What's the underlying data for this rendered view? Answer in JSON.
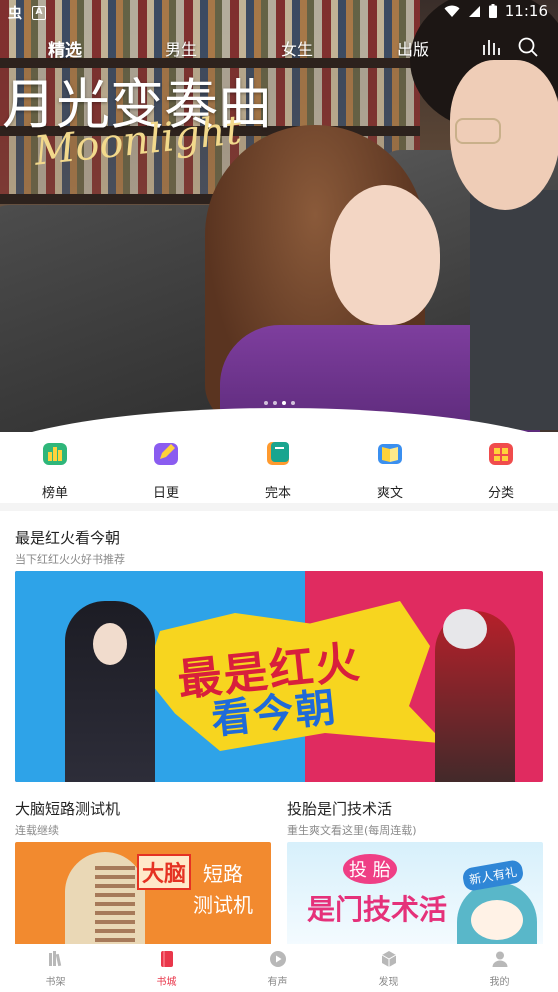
{
  "status_bar": {
    "app_glyph": "虫",
    "a_glyph": "A",
    "time": "11:16"
  },
  "top_tabs": [
    {
      "label": "精选",
      "active": true
    },
    {
      "label": "男生",
      "active": false
    },
    {
      "label": "女生",
      "active": false
    },
    {
      "label": "出版",
      "active": false
    }
  ],
  "hero": {
    "title": "月光变奏曲",
    "subtitle": "Moonlight",
    "dots": 4,
    "active_dot": 3
  },
  "categories": [
    {
      "label": "榜单",
      "icon": "leaderboard-icon",
      "color": "#2fb67a"
    },
    {
      "label": "日更",
      "icon": "pencil-icon",
      "color": "#8a5cf0"
    },
    {
      "label": "完本",
      "icon": "book-icon",
      "color": "#19a58f"
    },
    {
      "label": "爽文",
      "icon": "open-book-icon",
      "color": "#3a8ff0"
    },
    {
      "label": "分类",
      "icon": "grid-icon",
      "color": "#f04c4c"
    }
  ],
  "feature": {
    "title": "最是红火看今朝",
    "subtitle": "当下红红火火好书推荐",
    "banner_line1": "最是红火",
    "banner_line2": "看今朝"
  },
  "books": [
    {
      "title": "大脑短路测试机",
      "subtitle": "连载继续",
      "cover_word1": "大脑",
      "cover_word2": "短路",
      "cover_word3": "测试机"
    },
    {
      "title": "投胎是门技术活",
      "subtitle": "重生爽文看这里(每周连载)",
      "cover_word1": "投 胎",
      "cover_word2": "是门技术活",
      "cover_badge": "新人有礼"
    }
  ],
  "bottom_nav": [
    {
      "label": "书架",
      "active": false,
      "icon": "bookshelf-icon"
    },
    {
      "label": "书城",
      "active": true,
      "icon": "bookstore-icon"
    },
    {
      "label": "有声",
      "active": false,
      "icon": "play-icon"
    },
    {
      "label": "发现",
      "active": false,
      "icon": "cube-icon"
    },
    {
      "label": "我的",
      "active": false,
      "icon": "user-icon"
    }
  ],
  "colors": {
    "accent": "#e9374b",
    "nav_inactive": "#888888"
  }
}
